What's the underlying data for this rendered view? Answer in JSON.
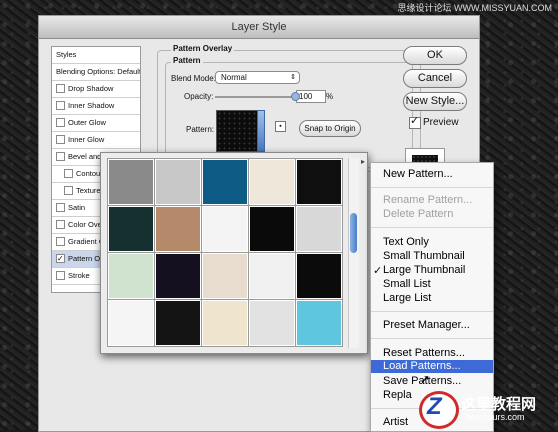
{
  "watermark": "思缘设计论坛 WWW.MISSYUAN.COM",
  "dialog": {
    "title": "Layer Style"
  },
  "styles": [
    {
      "label": "Styles",
      "type": "header"
    },
    {
      "label": "Blending Options: Default",
      "type": "header"
    },
    {
      "label": "Drop Shadow",
      "checked": false
    },
    {
      "label": "Inner Shadow",
      "checked": false
    },
    {
      "label": "Outer Glow",
      "checked": false
    },
    {
      "label": "Inner Glow",
      "checked": false
    },
    {
      "label": "Bevel and E",
      "checked": false
    },
    {
      "label": "Contour",
      "checked": false,
      "indent": true
    },
    {
      "label": "Texture",
      "checked": false,
      "indent": true
    },
    {
      "label": "Satin",
      "checked": false
    },
    {
      "label": "Color Over",
      "checked": false
    },
    {
      "label": "Gradient O",
      "checked": false
    },
    {
      "label": "Pattern Ov",
      "checked": true,
      "selected": true
    },
    {
      "label": "Stroke",
      "checked": false
    }
  ],
  "overlay": {
    "group_title": "Pattern Overlay",
    "sub_title": "Pattern",
    "blend_label": "Blend Mode:",
    "blend_value": "Normal",
    "opacity_label": "Opacity:",
    "opacity_value": "100",
    "opacity_unit": "%",
    "opacity_level": 1.0,
    "pattern_label": "Pattern:",
    "snap_button": "Snap to Origin"
  },
  "right_buttons": {
    "ok": "OK",
    "cancel": "Cancel",
    "new_style": "New Style...",
    "preview": "Preview",
    "preview_checked": true
  },
  "pattern_tiles": [
    {
      "color": "#8a8a8a",
      "name": "gray-noise"
    },
    {
      "color": "#c8c8c8",
      "name": "light-gray"
    },
    {
      "color": "#0e5c85",
      "name": "blue"
    },
    {
      "color": "#efe7d9",
      "name": "cream"
    },
    {
      "color": "#0f0f0f",
      "name": "black"
    },
    {
      "color": "#16302f",
      "name": "dark-teal"
    },
    {
      "color": "#b58a6a",
      "name": "tan"
    },
    {
      "color": "#f4f4f4",
      "name": "white"
    },
    {
      "color": "#0a0a0a",
      "name": "black-2"
    },
    {
      "color": "#d8d8d8",
      "name": "silver"
    },
    {
      "color": "#cfe3cf",
      "name": "pale-green"
    },
    {
      "color": "#151020",
      "name": "dark-purple"
    },
    {
      "color": "#e8dccf",
      "name": "beige"
    },
    {
      "color": "#f0f0f0",
      "name": "white-2"
    },
    {
      "color": "#0b0b0b",
      "name": "black-3"
    },
    {
      "color": "#f5f5f5",
      "name": "white-3"
    },
    {
      "color": "#141414",
      "name": "black-stripes"
    },
    {
      "color": "#efe5cf",
      "name": "wood-light"
    },
    {
      "color": "#e2e2e2",
      "name": "stripes-gray"
    },
    {
      "color": "#5fc6e0",
      "name": "sky-blue"
    }
  ],
  "menu": {
    "new_pattern": "New Pattern...",
    "rename_pattern": "Rename Pattern...",
    "delete_pattern": "Delete Pattern",
    "text_only": "Text Only",
    "small_thumbnail": "Small Thumbnail",
    "large_thumbnail": "Large Thumbnail",
    "small_list": "Small List",
    "large_list": "Large List",
    "preset_manager": "Preset Manager...",
    "reset_patterns": "Reset Patterns...",
    "load_patterns": "Load Patterns...",
    "save_patterns": "Save Patterns...",
    "replace_patterns": "Repla",
    "artist": "Artist"
  },
  "logo": {
    "cn": "这里教程网",
    "url": "herecours.com"
  }
}
